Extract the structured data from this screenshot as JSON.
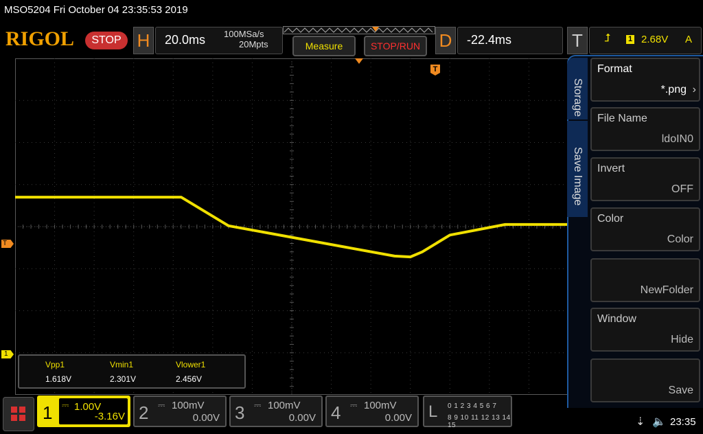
{
  "status_line": "MSO5204  Fri October 04 23:35:53 2019",
  "brand": {
    "logo": "RIGOL",
    "run_state": "STOP"
  },
  "horizontal": {
    "letter": "H",
    "timebase": "20.0ms",
    "sample_rate": "100MSa/s",
    "memory_depth": "20Mpts"
  },
  "buttons": {
    "measure": "Measure",
    "stop_run": "STOP/RUN"
  },
  "delay": {
    "letter": "D",
    "value": "-22.4ms"
  },
  "trigger": {
    "letter": "T",
    "edge_icon": "rising-edge-icon",
    "edge_glyph": "⮥",
    "source": "1",
    "level": "2.68V",
    "mode": "A"
  },
  "markers": {
    "trigger_level": "T",
    "channel1": "1",
    "trigger_time": "T"
  },
  "measurements": {
    "labels": [
      "Vpp1",
      "Vmin1",
      "Vlower1"
    ],
    "values": [
      "1.618V",
      "2.301V",
      "2.456V"
    ]
  },
  "side_menu": {
    "tab_storage": "Storage",
    "tab_save_image": "Save Image",
    "items": [
      {
        "title": "Format",
        "value": "*.png"
      },
      {
        "title": "File Name",
        "value": "ldoIN0"
      },
      {
        "title": "Invert",
        "value": "OFF"
      },
      {
        "title": "Color",
        "value": "Color"
      },
      {
        "title": "",
        "value": "NewFolder"
      },
      {
        "title": "Window",
        "value": "Hide"
      },
      {
        "title": "",
        "value": "Save"
      }
    ]
  },
  "channels": [
    {
      "num": "1",
      "scale": "1.00V",
      "offset": "-3.16V",
      "active": true
    },
    {
      "num": "2",
      "scale": "100mV",
      "offset": "0.00V",
      "active": false
    },
    {
      "num": "3",
      "scale": "100mV",
      "offset": "0.00V",
      "active": false
    },
    {
      "num": "4",
      "scale": "100mV",
      "offset": "0.00V",
      "active": false
    }
  ],
  "coupling_glyph": "⎓",
  "logic": {
    "letter": "L",
    "row1": "0 1 2 3  4 5 6 7",
    "row2": "8 9 10 11 12 13 14 15"
  },
  "tray": {
    "usb_glyph": "⇣",
    "speaker_glyph": "🔈",
    "clock": "23:35"
  },
  "colors": {
    "ch1": "#f0e000",
    "trigger": "#f08a20",
    "menu_border": "#1e5aa0",
    "stop": "#c83030"
  },
  "waveform": {
    "trace_color": "#f0e000",
    "description": "CH1 voltage trace in screen divisions from top (0-8) vs time division (0-14)",
    "points": [
      [
        0,
        3.3
      ],
      [
        4.2,
        3.3
      ],
      [
        5.4,
        3.98
      ],
      [
        9.6,
        4.7
      ],
      [
        10.0,
        4.72
      ],
      [
        10.3,
        4.6
      ],
      [
        11.0,
        4.2
      ],
      [
        12.4,
        3.95
      ],
      [
        13.5,
        3.95
      ],
      [
        14.0,
        3.95
      ]
    ]
  }
}
